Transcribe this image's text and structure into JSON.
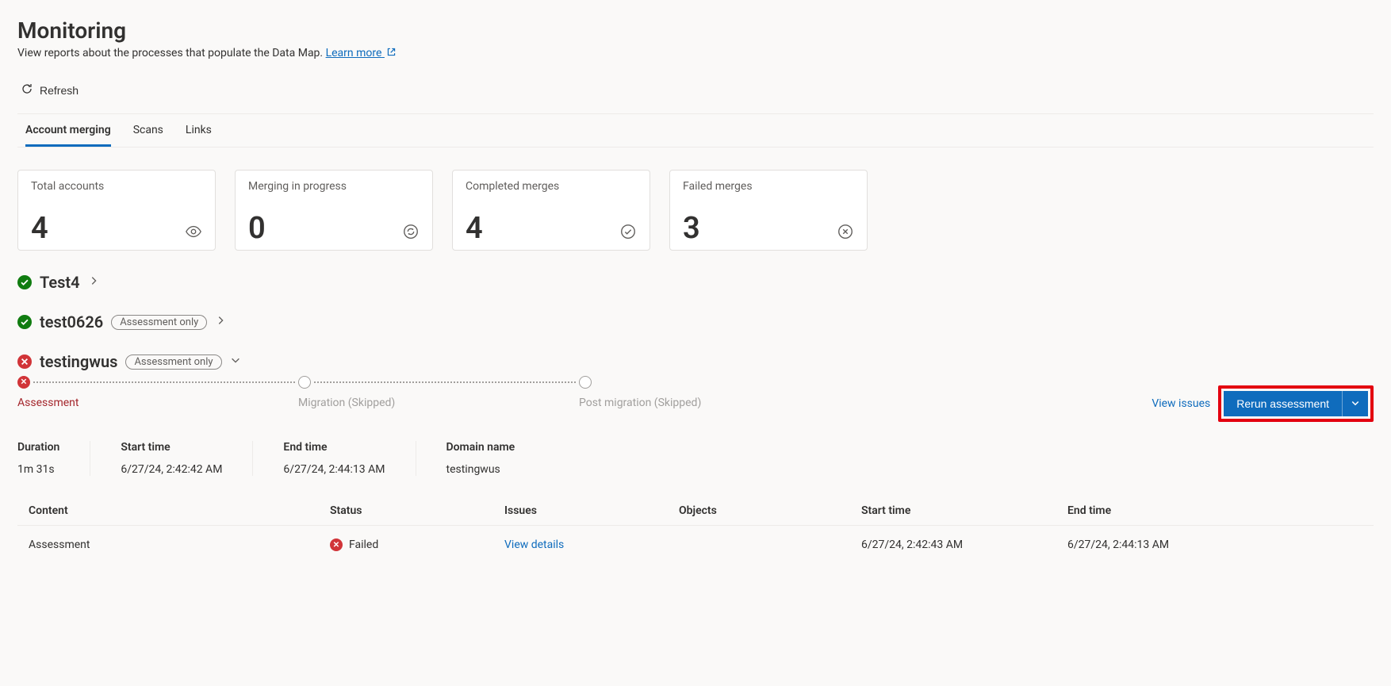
{
  "header": {
    "title": "Monitoring",
    "subtitle_prefix": "View reports about the processes that populate the Data Map. ",
    "learn_more_label": "Learn more"
  },
  "toolbar": {
    "refresh_label": "Refresh"
  },
  "tabs": [
    {
      "label": "Account merging",
      "active": true
    },
    {
      "label": "Scans",
      "active": false
    },
    {
      "label": "Links",
      "active": false
    }
  ],
  "summary_cards": [
    {
      "label": "Total accounts",
      "value": "4",
      "icon": "eye"
    },
    {
      "label": "Merging in progress",
      "value": "0",
      "icon": "sync"
    },
    {
      "label": "Completed merges",
      "value": "4",
      "icon": "check-circle"
    },
    {
      "label": "Failed merges",
      "value": "3",
      "icon": "x-circle"
    }
  ],
  "accounts": [
    {
      "name": "Test4",
      "status": "success",
      "badge": null,
      "expandable": true,
      "expanded": false
    },
    {
      "name": "test0626",
      "status": "success",
      "badge": "Assessment only",
      "expandable": true,
      "expanded": false
    },
    {
      "name": "testingwus",
      "status": "error",
      "badge": "Assessment only",
      "expandable": true,
      "expanded": true
    }
  ],
  "expanded": {
    "steps": [
      {
        "label": "Assessment",
        "state": "error"
      },
      {
        "label": "Migration (Skipped)",
        "state": "skipped"
      },
      {
        "label": "Post migration (Skipped)",
        "state": "skipped"
      }
    ],
    "actions": {
      "view_issues_label": "View issues",
      "rerun_label": "Rerun assessment"
    },
    "details": {
      "duration_label": "Duration",
      "duration_value": "1m 31s",
      "start_label": "Start time",
      "start_value": "6/27/24, 2:42:42 AM",
      "end_label": "End time",
      "end_value": "6/27/24, 2:44:13 AM",
      "domain_label": "Domain name",
      "domain_value": "testingwus"
    },
    "table": {
      "columns": [
        "Content",
        "Status",
        "Issues",
        "Objects",
        "Start time",
        "End time"
      ],
      "rows": [
        {
          "content": "Assessment",
          "status": "Failed",
          "issues": "View details",
          "objects": "",
          "start": "6/27/24, 2:42:43 AM",
          "end": "6/27/24, 2:44:13 AM"
        }
      ]
    }
  }
}
